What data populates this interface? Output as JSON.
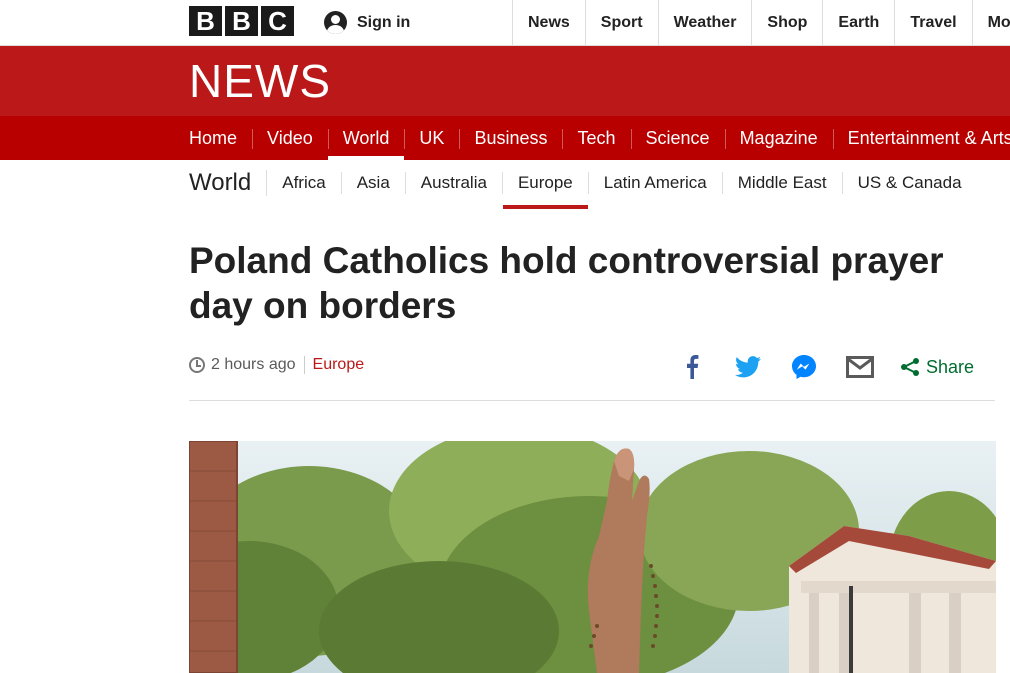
{
  "topbar": {
    "logo_letters": [
      "B",
      "B",
      "C"
    ],
    "signin_label": "Sign in",
    "nav": [
      "News",
      "Sport",
      "Weather",
      "Shop",
      "Earth",
      "Travel",
      "Mo"
    ]
  },
  "banner": {
    "title": "NEWS"
  },
  "main_nav": {
    "items": [
      "Home",
      "Video",
      "World",
      "UK",
      "Business",
      "Tech",
      "Science",
      "Magazine",
      "Entertainment & Arts"
    ],
    "active": "World"
  },
  "sub_nav": {
    "section_title": "World",
    "items": [
      "Africa",
      "Asia",
      "Australia",
      "Europe",
      "Latin America",
      "Middle East",
      "US & Canada"
    ],
    "active": "Europe"
  },
  "article": {
    "headline": "Poland Catholics hold controversial prayer day on borders",
    "timestamp": "2 hours ago",
    "section": "Europe",
    "share_label": "Share",
    "share_icons": [
      "facebook-icon",
      "twitter-icon",
      "messenger-icon",
      "email-icon",
      "share-icon"
    ]
  },
  "colors": {
    "brand_red": "#bb1919",
    "nav_red": "#b80000",
    "share_green": "#006d30",
    "facebook_blue": "#3b5998",
    "twitter_blue": "#1da1f2",
    "messenger_blue": "#0084ff"
  }
}
